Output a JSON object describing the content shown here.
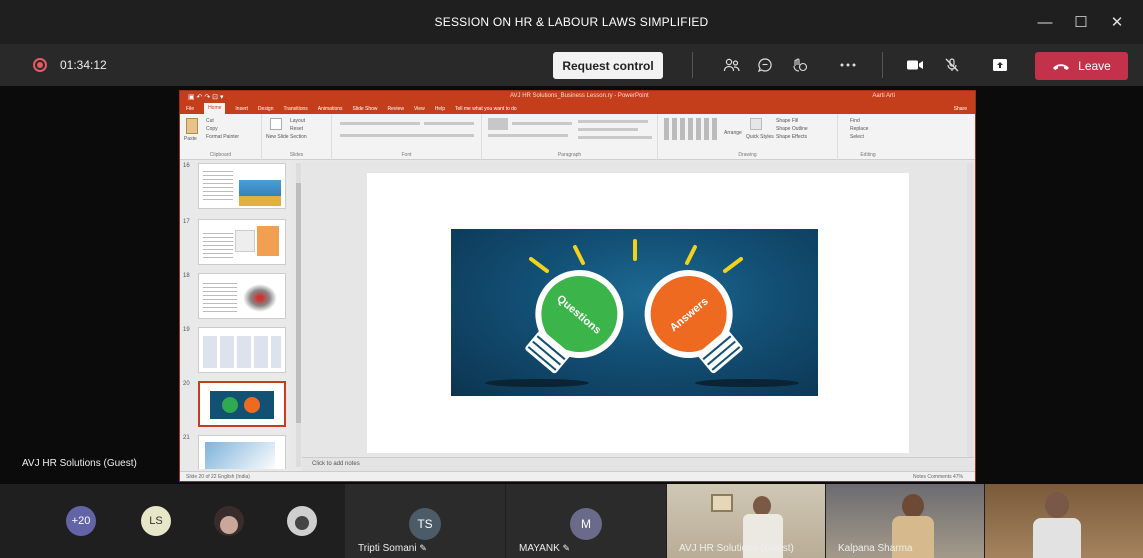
{
  "window": {
    "title": "SESSION ON HR & LABOUR LAWS SIMPLIFIED",
    "minimize": "—",
    "maximize": "☐",
    "close": "✕"
  },
  "call": {
    "timer": "01:34:12",
    "request_control": "Request control",
    "leave": "Leave",
    "icons": [
      "participants-icon",
      "chat-icon",
      "reactions-icon",
      "more-icon",
      "camera-icon",
      "mic-off-icon",
      "share-icon"
    ],
    "accent_leave": "#c4314b"
  },
  "ppt": {
    "window_title": "AVJ HR Solutions_Business Lesson.ry - PowerPoint",
    "user": "Aarti Arti",
    "tabs": [
      "File",
      "Home",
      "Insert",
      "Design",
      "Transitions",
      "Animations",
      "Slide Show",
      "Review",
      "View",
      "Help",
      "Tell me what you want to do"
    ],
    "active_tab": "Home",
    "share": "Share",
    "ribbon_groups": [
      "Clipboard",
      "Slides",
      "Font",
      "Paragraph",
      "Drawing",
      "Editing"
    ],
    "clipboard_items": [
      "Cut",
      "Copy",
      "Format Painter",
      "Paste"
    ],
    "slides_items": [
      "New Slide",
      "Layout",
      "Reset",
      "Section"
    ],
    "editing_items": [
      "Find",
      "Replace",
      "Select"
    ],
    "drawing_items": [
      "Arrange",
      "Quick Styles",
      "Shape Fill",
      "Shape Outline",
      "Shape Effects"
    ],
    "thumb_numbers": [
      "16",
      "17",
      "18",
      "19",
      "20",
      "21"
    ],
    "selected_slide": "20",
    "notes_placeholder": "Click to add notes",
    "status_left": "Slide 20 of 22  English (India)",
    "status_right": "Notes  Comments  47%",
    "slide_words": {
      "left": "Questions",
      "right": "Answers"
    }
  },
  "presenter_label": "AVJ HR Solutions (Guest)",
  "participants": {
    "overflow": "+20",
    "ls": "LS",
    "tiles": [
      {
        "initials": "TS",
        "name": "Tripti Somani"
      },
      {
        "initials": "M",
        "name": "MAYANK"
      }
    ],
    "video_tiles": [
      {
        "name": "AVJ HR Solutions (Guest)"
      },
      {
        "name": "Kalpana Sharma"
      },
      {
        "name": ""
      }
    ]
  }
}
